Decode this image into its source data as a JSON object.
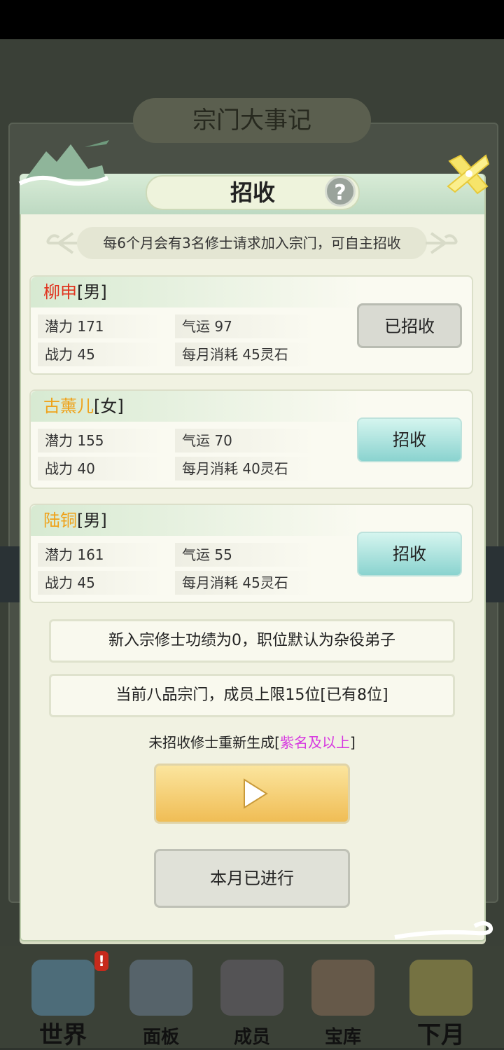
{
  "background": {
    "title": "宗门大事记"
  },
  "dialog": {
    "title": "招收",
    "help_icon": "?",
    "notice": "每6个月会有3名修士请求加入宗门，可自主招收",
    "candidates": [
      {
        "name": "柳申",
        "sex": "[男]",
        "name_color": "#e0341f",
        "potential": "潜力 171",
        "luck": "气运 97",
        "power": "战力 45",
        "cost": "每月消耗 45灵石",
        "button": "已招收",
        "state": "recruited"
      },
      {
        "name": "古薰儿",
        "sex": "[女]",
        "name_color": "#efa21a",
        "potential": "潜力 155",
        "luck": "气运 70",
        "power": "战力 40",
        "cost": "每月消耗 40灵石",
        "button": "招收",
        "state": "available"
      },
      {
        "name": "陆铜",
        "sex": "[男]",
        "name_color": "#efa21a",
        "potential": "潜力 161",
        "luck": "气运 55",
        "power": "战力 45",
        "cost": "每月消耗 45灵石",
        "button": "招收",
        "state": "available"
      }
    ],
    "info_merit": "新入宗修士功绩为0，职位默认为杂役弟子",
    "info_capacity": "当前八品宗门，成员上限15位[已有8位]",
    "regen_prefix": "未招收修士重新生成[",
    "regen_highlight": "紫名及以上",
    "regen_suffix": "]",
    "done_label": "本月已进行"
  },
  "nav": {
    "items": [
      {
        "label": "世界",
        "icon": "world-icon"
      },
      {
        "label": "面板",
        "icon": "panel-icon"
      },
      {
        "label": "成员",
        "icon": "members-icon"
      },
      {
        "label": "宝库",
        "icon": "treasury-icon"
      },
      {
        "label": "下月",
        "icon": "next-month-icon"
      }
    ],
    "badge": "!"
  },
  "colors": {
    "accent_teal": "#8ad3cf",
    "gold": "#f0bd55",
    "highlight_purple": "#d636e0"
  }
}
